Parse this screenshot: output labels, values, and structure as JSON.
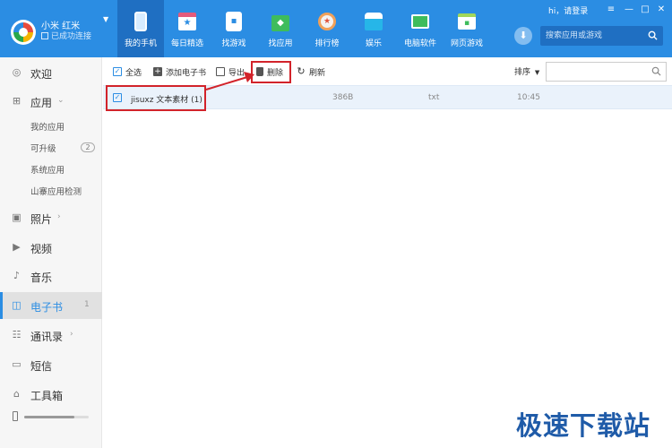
{
  "device": {
    "name": "小米 红米",
    "status": "已成功连接"
  },
  "nav": [
    {
      "label": "我的手机",
      "icon": "phone-icon",
      "active": true
    },
    {
      "label": "每日精选",
      "icon": "calendar-star-icon"
    },
    {
      "label": "找游戏",
      "icon": "gamepad-icon"
    },
    {
      "label": "找应用",
      "icon": "app-bag-icon"
    },
    {
      "label": "排行榜",
      "icon": "medal-icon"
    },
    {
      "label": "娱乐",
      "icon": "entertainment-icon"
    },
    {
      "label": "电脑软件",
      "icon": "pc-icon"
    },
    {
      "label": "网页游戏",
      "icon": "web-game-icon"
    }
  ],
  "header": {
    "greeting": "hi，请登录",
    "search_placeholder": "搜索应用或游戏"
  },
  "sidebar": {
    "items": [
      {
        "label": "欢迎",
        "icon": "welcome-icon"
      },
      {
        "label": "应用",
        "icon": "apps-grid-icon"
      },
      {
        "label": "照片",
        "icon": "photo-icon"
      },
      {
        "label": "视频",
        "icon": "video-icon"
      },
      {
        "label": "音乐",
        "icon": "music-icon"
      },
      {
        "label": "电子书",
        "icon": "book-icon",
        "count": "1",
        "active": true
      },
      {
        "label": "通讯录",
        "icon": "contacts-icon"
      },
      {
        "label": "短信",
        "icon": "sms-icon"
      },
      {
        "label": "工具箱",
        "icon": "toolbox-icon"
      }
    ],
    "sub_items": [
      {
        "label": "我的应用"
      },
      {
        "label": "可升级",
        "badge": "2"
      },
      {
        "label": "系统应用"
      },
      {
        "label": "山寨应用检测"
      }
    ],
    "storage_used": 0.78
  },
  "toolbar": {
    "select_all": "全选",
    "add_ebook": "添加电子书",
    "export": "导出",
    "delete": "删除",
    "refresh": "刷新",
    "sort": "排序"
  },
  "files": [
    {
      "name": "jisuxz 文本素材 (1)",
      "size": "386B",
      "type": "txt",
      "time": "10:45",
      "checked": true
    }
  ],
  "watermark": "极速下载站",
  "colors": {
    "brand": "#2b8de3",
    "highlight": "#d2232a",
    "selected_row": "#eaf2fb"
  }
}
